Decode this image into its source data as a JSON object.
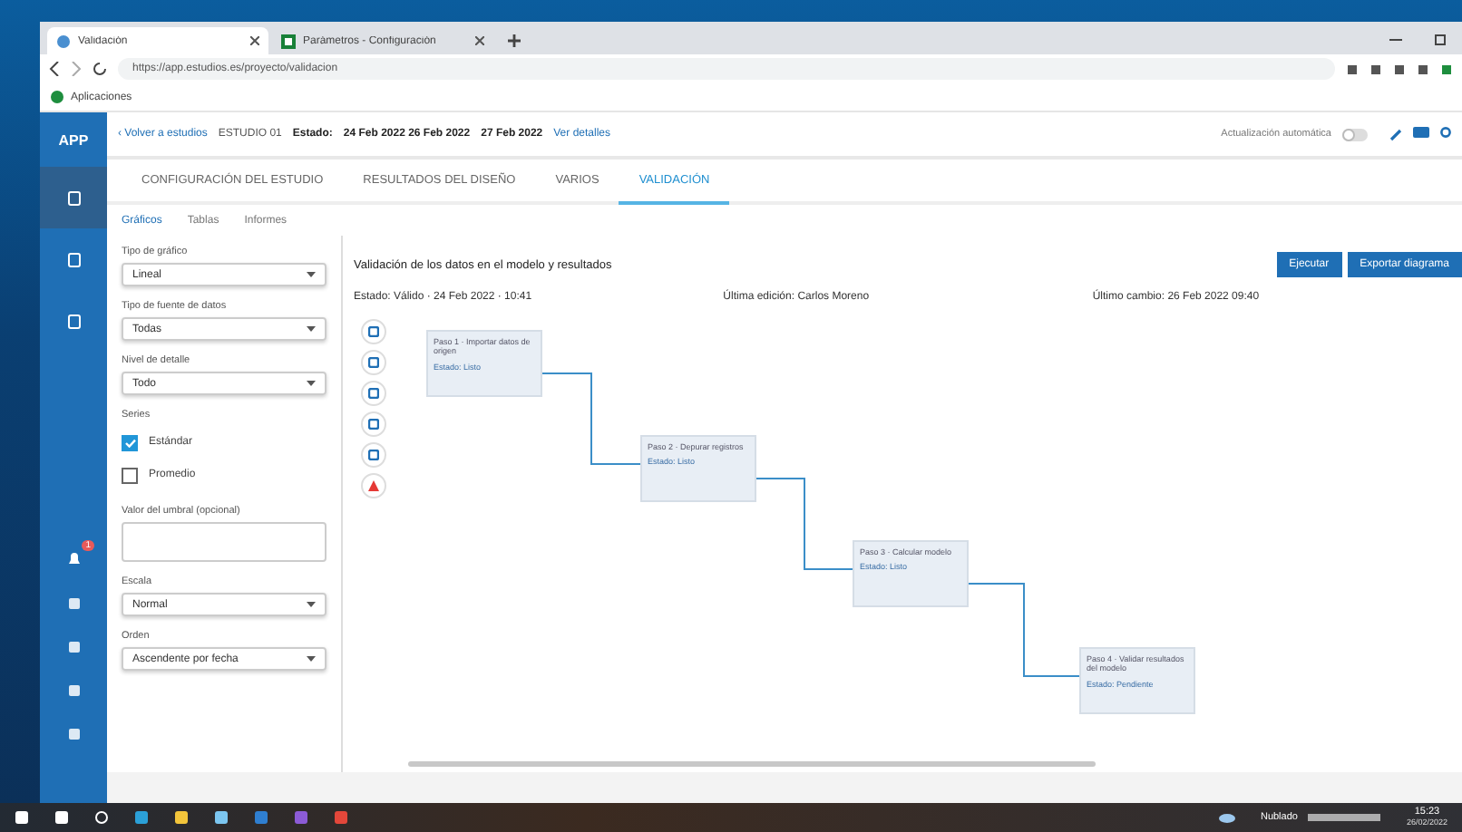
{
  "browser": {
    "tabs": [
      {
        "title": "Validación",
        "selected": true
      },
      {
        "title": "Parámetros - Configuración",
        "selected": false
      }
    ],
    "address": "https://app.estudios.es/proyecto/validacion",
    "bookmark": "Aplicaciones"
  },
  "app": {
    "logo": "APP",
    "breadcrumb": [
      {
        "text": "‹ Volver a estudios",
        "kind": "link"
      },
      {
        "text": "ESTUDIO 01",
        "kind": "plain"
      },
      {
        "text": "Estado:",
        "kind": "bold"
      },
      {
        "text": "24 Feb 2022  26 Feb 2022",
        "kind": "bold"
      },
      {
        "text": "27 Feb 2022",
        "kind": "bold"
      },
      {
        "text": "Ver detalles",
        "kind": "link"
      }
    ],
    "auto_label": "Actualización automática",
    "auto_on": false,
    "alert_count": "1",
    "tabs": [
      {
        "label": "CONFIGURACIÓN DEL ESTUDIO",
        "selected": false
      },
      {
        "label": "RESULTADOS DEL DISEÑO",
        "selected": false
      },
      {
        "label": "VARIOS",
        "selected": false
      },
      {
        "label": "VALIDACIÓN",
        "selected": true
      }
    ],
    "subtabs": [
      {
        "label": "Gráficos",
        "selected": true
      },
      {
        "label": "Tablas",
        "selected": false
      },
      {
        "label": "Informes",
        "selected": false
      }
    ],
    "filters": [
      {
        "kind": "select",
        "label": "Tipo de gráfico",
        "value": "Lineal"
      },
      {
        "kind": "select",
        "label": "Tipo de fuente de datos",
        "value": "Todas"
      },
      {
        "kind": "select",
        "label": "Nivel de detalle",
        "value": "Todo"
      },
      {
        "kind": "checks",
        "label": "Series",
        "items": [
          {
            "label": "Estándar",
            "checked": true
          },
          {
            "label": "Promedio",
            "checked": false
          }
        ]
      },
      {
        "kind": "textarea",
        "label": "Valor del umbral (opcional)"
      },
      {
        "kind": "select",
        "label": "Escala",
        "value": "Normal"
      },
      {
        "kind": "select",
        "label": "Orden",
        "value": "Ascendente por fecha"
      }
    ],
    "main": {
      "title": "Validación de los datos en el modelo y resultados",
      "buttons": [
        "Ejecutar",
        "Exportar diagrama"
      ],
      "info": [
        "Estado: Válido · 24 Feb 2022 · 10:41",
        "Última edición: Carlos Moreno",
        "Último cambio: 26 Feb 2022 09:40"
      ],
      "nodes": [
        {
          "title": "Paso 1 · Importar datos de origen",
          "subtitle": "Estado: Listo"
        },
        {
          "title": "Paso 2 · Depurar registros",
          "subtitle": "Estado: Listo"
        },
        {
          "title": "Paso 3 · Calcular modelo",
          "subtitle": "Estado: Listo"
        },
        {
          "title": "Paso 4 · Validar resultados del modelo",
          "subtitle": "Estado: Pendiente"
        }
      ]
    }
  },
  "taskbar": {
    "weather": "Nublado",
    "time": "15:23",
    "date": "26/02/2022"
  }
}
